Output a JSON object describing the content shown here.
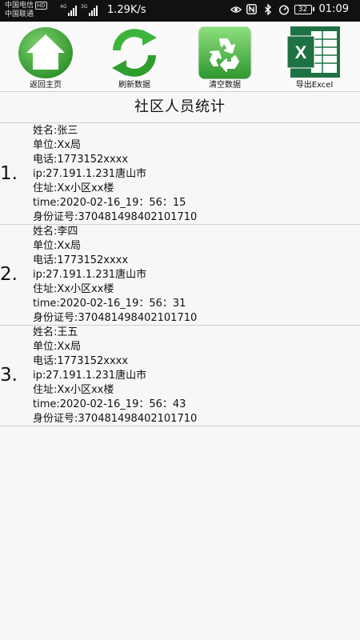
{
  "status_bar": {
    "carrier1": "中国电信",
    "carrier1_badge": "HD",
    "carrier2": "中国联通",
    "signal1_label": "4G",
    "signal2_label": "3G",
    "net_speed": "1.29K/s",
    "battery": "32",
    "time": "01:09",
    "icons": [
      "eye-icon",
      "nfc-icon",
      "bluetooth-icon",
      "timer-icon",
      "battery-icon"
    ]
  },
  "toolbar": {
    "home_label": "返回主页",
    "refresh_label": "刷新数据",
    "clear_label": "清空数据",
    "export_label": "导出Excel",
    "excel_letter": "X",
    "colors": {
      "home": "#3aaa35",
      "refresh": "#2eaa2e",
      "clear": "#39a839",
      "excel": "#1f7244"
    }
  },
  "page_title": "社区人员统计",
  "persons": [
    {
      "number": "1.",
      "name": "姓名:张三",
      "unit": "单位:Xx局",
      "phone": "电话:1773152xxxx",
      "ip": "ip:27.191.1.231唐山市",
      "address": "住址:Xx小区xx楼",
      "time": "time:2020-02-16_19：56：15",
      "id_number": "身份证号:370481498402101710"
    },
    {
      "number": "2.",
      "name": "姓名:李四",
      "unit": "单位:Xx局",
      "phone": "电话:1773152xxxx",
      "ip": "ip:27.191.1.231唐山市",
      "address": "住址:Xx小区xx楼",
      "time": "time:2020-02-16_19：56：31",
      "id_number": "身份证号:370481498402101710"
    },
    {
      "number": "3.",
      "name": "姓名:王五",
      "unit": "单位:Xx局",
      "phone": "电话:1773152xxxx",
      "ip": "ip:27.191.1.231唐山市",
      "address": "住址:Xx小区xx楼",
      "time": "time:2020-02-16_19：56：43",
      "id_number": "身份证号:370481498402101710"
    }
  ]
}
